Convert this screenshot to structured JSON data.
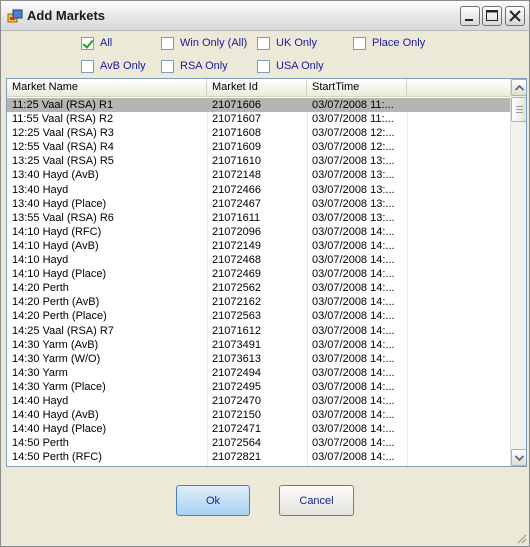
{
  "window": {
    "title": "Add Markets"
  },
  "filters": [
    {
      "label": "All",
      "checked": true
    },
    {
      "label": "Win Only (All)",
      "checked": false
    },
    {
      "label": "UK Only",
      "checked": false
    },
    {
      "label": "Place Only",
      "checked": false
    },
    {
      "label": "AvB Only",
      "checked": false
    },
    {
      "label": "RSA Only",
      "checked": false
    },
    {
      "label": "USA Only",
      "checked": false
    }
  ],
  "table": {
    "columns": [
      "Market Name",
      "Market Id",
      "StartTime"
    ],
    "selected_row": 0,
    "rows": [
      [
        "11:25 Vaal (RSA)  R1",
        "21071606",
        "03/07/2008 11:..."
      ],
      [
        "11:55 Vaal (RSA)  R2",
        "21071607",
        "03/07/2008 11:..."
      ],
      [
        "12:25 Vaal (RSA)  R3",
        "21071608",
        "03/07/2008 12:..."
      ],
      [
        "12:55 Vaal (RSA)  R4",
        "21071609",
        "03/07/2008 12:..."
      ],
      [
        "13:25 Vaal (RSA)  R5",
        "21071610",
        "03/07/2008 13:..."
      ],
      [
        "13:40 Hayd (AvB)",
        "21072148",
        "03/07/2008 13:..."
      ],
      [
        "13:40 Hayd",
        "21072466",
        "03/07/2008 13:..."
      ],
      [
        "13:40 Hayd  (Place)",
        "21072467",
        "03/07/2008 13:..."
      ],
      [
        "13:55 Vaal (RSA)  R6",
        "21071611",
        "03/07/2008 13:..."
      ],
      [
        "14:10 Hayd (RFC)",
        "21072096",
        "03/07/2008 14:..."
      ],
      [
        "14:10 Hayd (AvB)",
        "21072149",
        "03/07/2008 14:..."
      ],
      [
        "14:10 Hayd",
        "21072468",
        "03/07/2008 14:..."
      ],
      [
        "14:10 Hayd  (Place)",
        "21072469",
        "03/07/2008 14:..."
      ],
      [
        "14:20 Perth",
        "21072562",
        "03/07/2008 14:..."
      ],
      [
        "14:20 Perth (AvB)",
        "21072162",
        "03/07/2008 14:..."
      ],
      [
        "14:20 Perth  (Place)",
        "21072563",
        "03/07/2008 14:..."
      ],
      [
        "14:25 Vaal (RSA)  R7",
        "21071612",
        "03/07/2008 14:..."
      ],
      [
        "14:30 Yarm (AvB)",
        "21073491",
        "03/07/2008 14:..."
      ],
      [
        "14:30 Yarm (W/O)",
        "21073613",
        "03/07/2008 14:..."
      ],
      [
        "14:30 Yarm",
        "21072494",
        "03/07/2008 14:..."
      ],
      [
        "14:30 Yarm  (Place)",
        "21072495",
        "03/07/2008 14:..."
      ],
      [
        "14:40 Hayd",
        "21072470",
        "03/07/2008 14:..."
      ],
      [
        "14:40 Hayd (AvB)",
        "21072150",
        "03/07/2008 14:..."
      ],
      [
        "14:40 Hayd  (Place)",
        "21072471",
        "03/07/2008 14:..."
      ],
      [
        "14:50 Perth",
        "21072564",
        "03/07/2008 14:..."
      ],
      [
        "14:50 Perth (RFC)",
        "21072821",
        "03/07/2008 14:..."
      ]
    ]
  },
  "buttons": {
    "ok": "Ok",
    "cancel": "Cancel"
  },
  "icons": {
    "app": "app-window-icon",
    "minimize": "minimize-icon",
    "maximize": "maximize-icon",
    "close": "close-icon",
    "scroll_up": "chevron-up-icon",
    "scroll_down": "chevron-down-icon"
  }
}
